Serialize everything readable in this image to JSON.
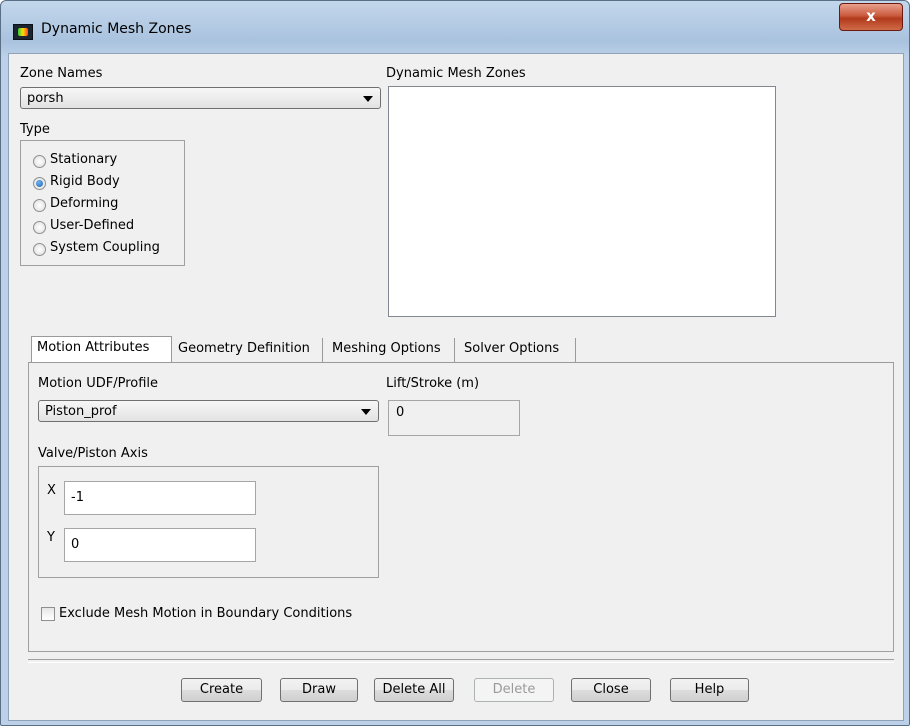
{
  "window": {
    "title": "Dynamic Mesh Zones",
    "close_label": "x"
  },
  "zone_names": {
    "label": "Zone Names",
    "selected": "porsh"
  },
  "type": {
    "label": "Type",
    "options": [
      {
        "label": "Stationary",
        "selected": false
      },
      {
        "label": "Rigid Body",
        "selected": true
      },
      {
        "label": "Deforming",
        "selected": false
      },
      {
        "label": "User-Defined",
        "selected": false
      },
      {
        "label": "System Coupling",
        "selected": false
      }
    ]
  },
  "dynamic_mesh_zones": {
    "label": "Dynamic Mesh Zones",
    "items": []
  },
  "tabs": [
    {
      "label": "Motion Attributes",
      "active": true
    },
    {
      "label": "Geometry Definition",
      "active": false
    },
    {
      "label": "Meshing Options",
      "active": false
    },
    {
      "label": "Solver Options",
      "active": false
    }
  ],
  "motion": {
    "udf_label": "Motion UDF/Profile",
    "udf_selected": "Piston_prof",
    "lift_label": "Lift/Stroke (m)",
    "lift_value": "0",
    "axis_label": "Valve/Piston Axis",
    "x_label": "X",
    "x_value": "-1",
    "y_label": "Y",
    "y_value": "0",
    "exclude_label": "Exclude Mesh Motion in Boundary Conditions",
    "exclude_checked": false
  },
  "buttons": {
    "create": "Create",
    "draw": "Draw",
    "delete_all": "Delete All",
    "delete": "Delete",
    "close": "Close",
    "help": "Help"
  }
}
